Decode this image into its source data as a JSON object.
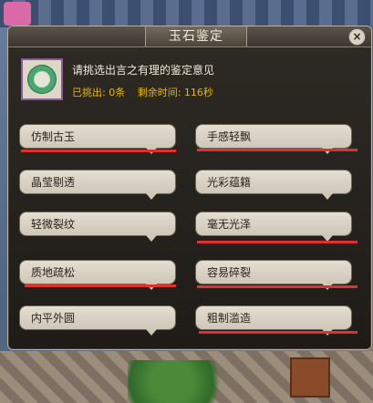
{
  "dialog": {
    "title": "玉石鉴定",
    "close_label": "×",
    "instruction": "请挑选出言之有理的鉴定意见",
    "status": {
      "selected": "已挑出: 0条",
      "time_left": "剩余时间: 116秒"
    }
  },
  "options": {
    "left": [
      "仿制古玉",
      "晶莹剔透",
      "轻微裂纹",
      "质地疏松",
      "内平外圆"
    ],
    "right": [
      "手感轻飘",
      "光彩蕴籍",
      "毫无光泽",
      "容易碎裂",
      "粗制滥造"
    ]
  },
  "colors": {
    "accent_underline": "#e03030",
    "status_text": "#e6b800",
    "jade_green": "#4aa56f"
  }
}
